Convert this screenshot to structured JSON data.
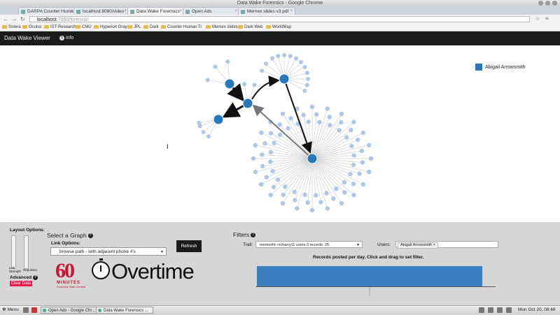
{
  "window": {
    "title": "Data Wake Forensics - Google Chrome"
  },
  "tabs": [
    {
      "label": "DARPA Counter Huma"
    },
    {
      "label": "localhost:8080/video"
    },
    {
      "label": "Data Wake Forensics",
      "active": true
    },
    {
      "label": "Open Ads"
    },
    {
      "label": "Memex slides v3.pdf"
    }
  ],
  "address": {
    "host": "localhost",
    "path": ":7080/forensic/"
  },
  "bookmarks": [
    "Sotera",
    "Oculus",
    "IST Research",
    "CMU",
    "Hyperion Gray",
    "JPL",
    "Dark",
    "Counter Human Tr",
    "Memex slides",
    "Dark Web",
    "WorldMap"
  ],
  "app": {
    "title": "Data Wake Viewer",
    "info_label": "info"
  },
  "legend": {
    "user": "Abigail Arrowsmith",
    "color": "#2778b8"
  },
  "graph": {
    "node_color": "#2778b8",
    "leaf_color": "#aec7e8",
    "main_nodes": 5,
    "leaf_count_hub": 72
  },
  "layout_options": {
    "label": "Layout Options:",
    "slider_labels": [
      "Link Strength",
      "Repulsion"
    ],
    "advanced_label": "Advanced",
    "clear_label": "Clear Data"
  },
  "select_graph": {
    "title": "Select a Graph",
    "link_options_label": "Link Options:",
    "link_option_value": "browse path - with adjacent phone #'s",
    "refresh_label": "Refresh"
  },
  "logo": {
    "number": "60",
    "minutes": "MINUTES",
    "word": "Overtime",
    "subtext": "Exclusive Web Content"
  },
  "filters": {
    "title": "Filters",
    "trail_label": "Trail:",
    "trail_value": "memexht->rcharry11 users:3 records: 25",
    "users_label": "Users:",
    "users_tag": "Abigail Arrowsmith",
    "chart_title": "Records posted per day. Click and drag to set filter."
  },
  "chart_data": {
    "type": "bar",
    "title": "Records posted per day. Click and drag to set filter.",
    "categories": [
      ""
    ],
    "values": [
      25
    ],
    "color": "#3a7ebf"
  },
  "taskbar": {
    "menu_label": "Menu",
    "tasks": [
      "Open Ads - Google Chr...",
      "Data Wake Forensics ..."
    ],
    "clock": "Mon Oct 20, 08:48"
  }
}
